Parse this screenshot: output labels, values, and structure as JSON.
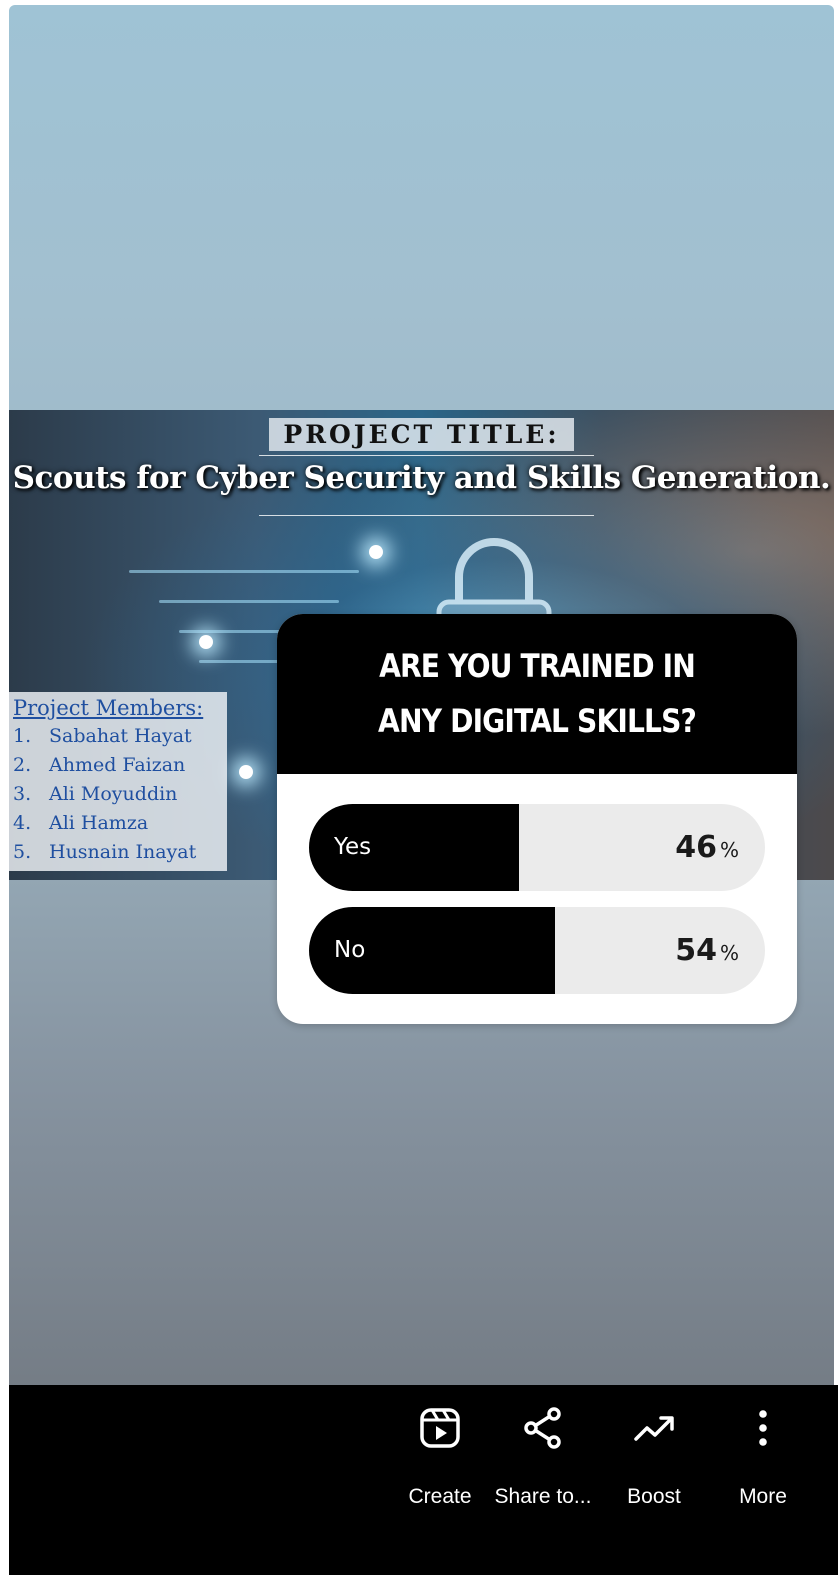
{
  "banner": {
    "title_label": "PROJECT TITLE:",
    "title_text": "Scouts for Cyber Security and Skills Generation.",
    "members_heading": "Project Members:",
    "members": [
      {
        "num": "1.",
        "name": "Sabahat Hayat"
      },
      {
        "num": "2.",
        "name": "Ahmed Faizan"
      },
      {
        "num": "3.",
        "name": "Ali Moyuddin"
      },
      {
        "num": "4.",
        "name": "Ali Hamza"
      },
      {
        "num": "5.",
        "name": "Husnain Inayat"
      }
    ]
  },
  "poll": {
    "question": "ARE YOU TRAINED IN ANY DIGITAL SKILLS?",
    "options": [
      {
        "label": "Yes",
        "percent": "46",
        "percent_sign": "%",
        "fraction": 0.46
      },
      {
        "label": "No",
        "percent": "54",
        "percent_sign": "%",
        "fraction": 0.54
      }
    ]
  },
  "actions": [
    {
      "label": "Create",
      "icon": "reels-icon"
    },
    {
      "label": "Share to...",
      "icon": "share-icon"
    },
    {
      "label": "Boost",
      "icon": "trending-up-icon"
    },
    {
      "label": "More",
      "icon": "more-vertical-icon"
    }
  ]
}
